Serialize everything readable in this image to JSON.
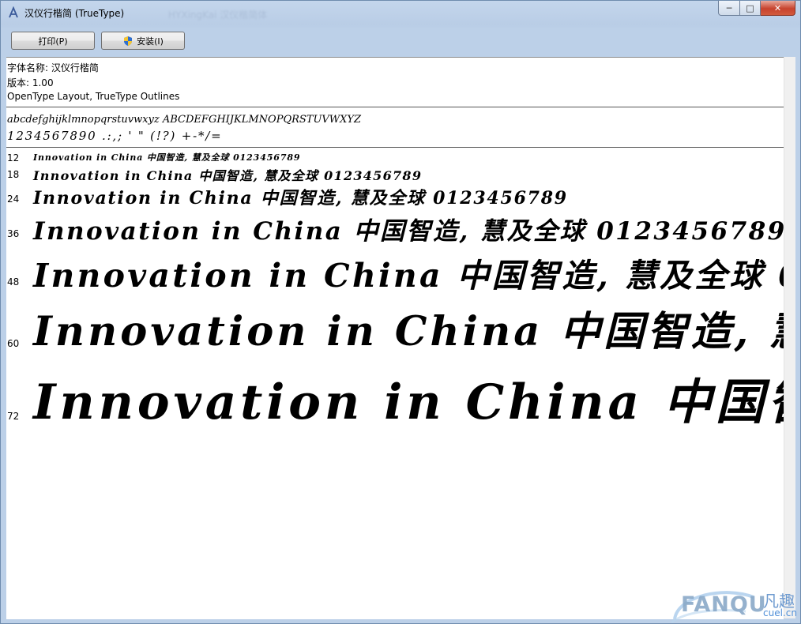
{
  "window": {
    "title": "汉仪行楷简 (TrueType)",
    "ghost_title": "HYXingKai 汉仪楷简体"
  },
  "caption_buttons": {
    "minimize": "─",
    "maximize": "□",
    "close": "✕"
  },
  "toolbar": {
    "print_label": "打印(P)",
    "install_label": "安装(I)",
    "install_icon": "uac-shield-icon"
  },
  "font_info": {
    "name_line": "字体名称: 汉仪行楷简",
    "version_line": "版本: 1.00",
    "features_line": "OpenType Layout, TrueType Outlines"
  },
  "charset": {
    "lower_line": "abcdefghijklmnopqrstuvwxyz  ABCDEFGHIJKLMNOPQRSTUVWXYZ",
    "digits_line": "1234567890 .:,; ' \" (!?) +-*/="
  },
  "sample": {
    "text": "Innovation in China 中国智造, 慧及全球 0123456789",
    "sizes": [
      "12",
      "18",
      "24",
      "36",
      "48",
      "60",
      "72"
    ]
  },
  "watermark": {
    "brand": "FANQU",
    "cn": "凡趣",
    "url": "cuel.cn"
  }
}
